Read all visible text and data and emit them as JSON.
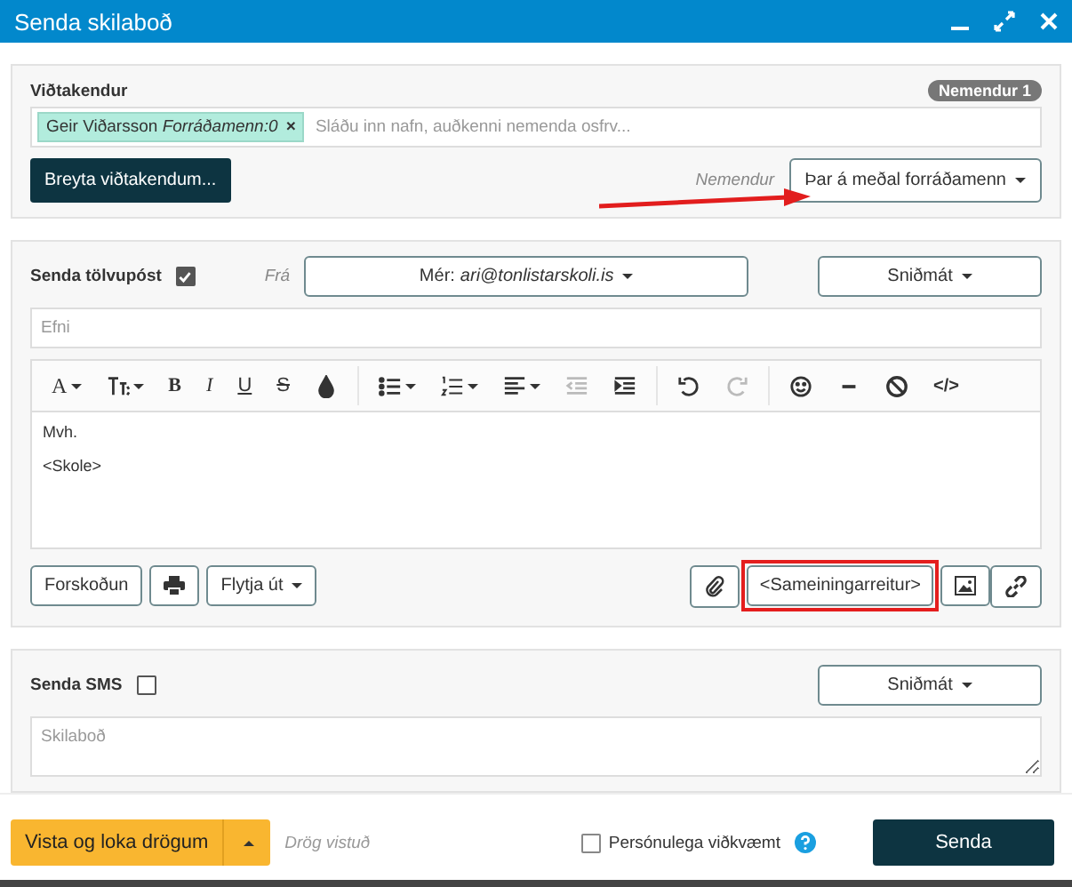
{
  "window": {
    "title": "Senda skilaboð"
  },
  "recipients": {
    "label": "Viðtakendur",
    "count_badge": "Nemendur 1",
    "tokens": [
      {
        "name": "Geir Viðarsson",
        "role": "Forráðamenn:0",
        "remove": "×"
      }
    ],
    "placeholder": "Sláðu inn nafn, auðkenni nemenda osfrv...",
    "edit_button": "Breyta viðtakendum...",
    "audience_label": "Nemendur",
    "audience_select": "Þar á meðal forráðamenn",
    "highlighted": true
  },
  "email": {
    "label": "Senda tölvupóst",
    "checked": true,
    "from_label": "Frá",
    "from_prefix": "Mér:",
    "from_address": "ari@tonlistarskoli.is",
    "template_button": "Sniðmát",
    "subject_placeholder": "Efni",
    "toolbar": [
      [
        {
          "kind": "font",
          "label": "A",
          "dropdown": true,
          "disabled": false
        },
        {
          "kind": "size",
          "dropdown": true,
          "disabled": false
        },
        {
          "kind": "bold",
          "label": "B",
          "dropdown": false,
          "disabled": false
        },
        {
          "kind": "italic",
          "label": "I",
          "dropdown": false,
          "disabled": false
        },
        {
          "kind": "underline",
          "label": "U",
          "dropdown": false,
          "disabled": false
        },
        {
          "kind": "strike",
          "label": "S",
          "dropdown": false,
          "disabled": false
        },
        {
          "kind": "color",
          "dropdown": false,
          "disabled": false
        }
      ],
      [
        {
          "kind": "bullets",
          "dropdown": true,
          "disabled": false
        },
        {
          "kind": "numbers",
          "dropdown": true,
          "disabled": false
        },
        {
          "kind": "align",
          "dropdown": true,
          "disabled": false
        },
        {
          "kind": "outdent",
          "dropdown": false,
          "disabled": true
        },
        {
          "kind": "indent",
          "dropdown": false,
          "disabled": false
        }
      ],
      [
        {
          "kind": "undo",
          "dropdown": false,
          "disabled": false
        },
        {
          "kind": "redo",
          "dropdown": false,
          "disabled": true
        }
      ],
      [
        {
          "kind": "emoji",
          "dropdown": false,
          "disabled": false
        },
        {
          "kind": "rule",
          "dropdown": false,
          "disabled": false
        },
        {
          "kind": "clear",
          "dropdown": false,
          "disabled": false
        },
        {
          "kind": "code",
          "label": "</>",
          "dropdown": false,
          "disabled": false
        }
      ]
    ],
    "body": [
      "Mvh.",
      "<Skole>"
    ],
    "preview_button": "Forskoðun",
    "export_button": "Flytja út",
    "merge_field_button": "<Sameiningarreitur>",
    "merge_highlighted": true
  },
  "sms": {
    "label": "Senda SMS",
    "checked": false,
    "template_button": "Sniðmát",
    "placeholder": "Skilaboð"
  },
  "footer": {
    "save_button": "Vista og loka drögum",
    "draft_status": "Drög vistuð",
    "personal_label": "Persónulega viðkvæmt",
    "personal_checked": false,
    "send_button": "Senda"
  }
}
